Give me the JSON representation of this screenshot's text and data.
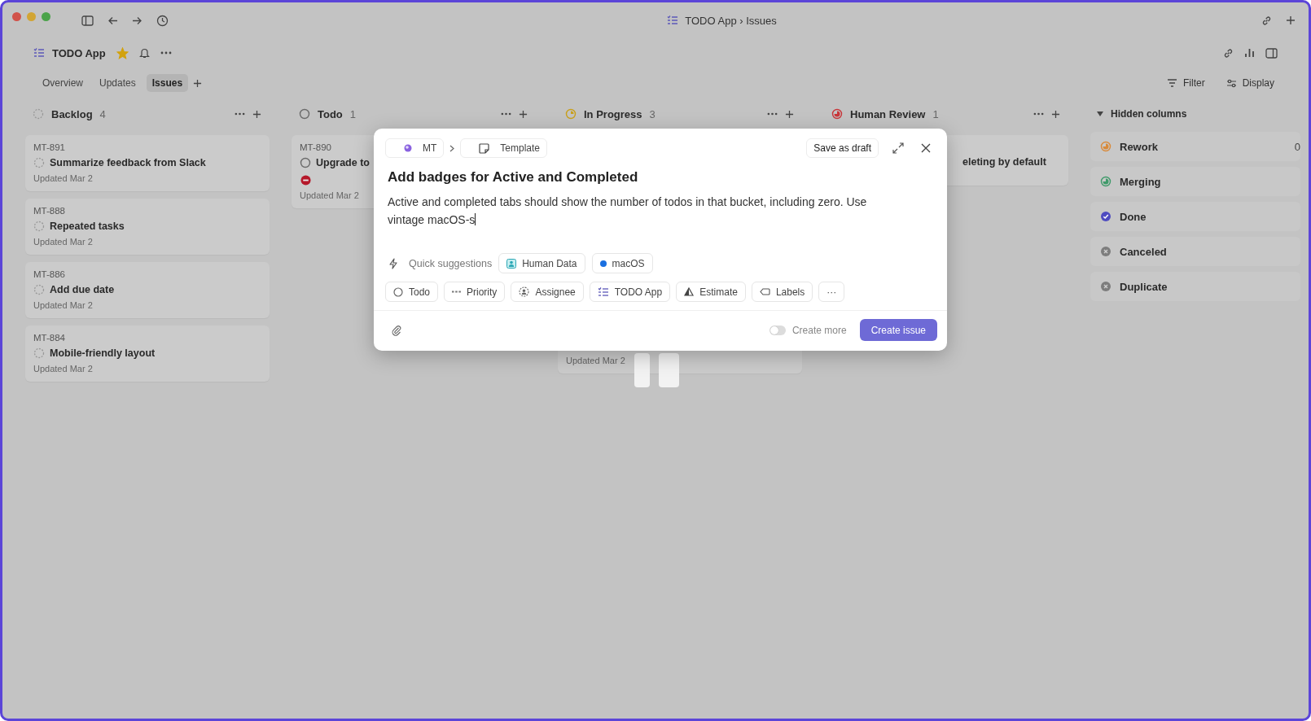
{
  "window": {
    "title": "TODO App › Issues"
  },
  "header": {
    "project": "TODO App",
    "starred": true
  },
  "tabs": [
    {
      "label": "Overview",
      "selected": false
    },
    {
      "label": "Updates",
      "selected": false
    },
    {
      "label": "Issues",
      "selected": true
    }
  ],
  "view_controls": [
    {
      "kind": "filter",
      "label": "Filter"
    },
    {
      "kind": "display",
      "label": "Display"
    }
  ],
  "columns": [
    {
      "name": "Backlog",
      "count": "4",
      "kind": "backlog",
      "cards": [
        {
          "id": "MT-891",
          "title": "Summarize feedback from Slack",
          "blocked": false,
          "updated": "Updated Mar 2"
        },
        {
          "id": "MT-888",
          "title": "Repeated tasks",
          "blocked": false,
          "updated": "Updated Mar 2"
        },
        {
          "id": "MT-886",
          "title": "Add due date",
          "blocked": false,
          "updated": "Updated Mar 2"
        },
        {
          "id": "MT-884",
          "title": "Mobile-friendly layout",
          "blocked": false,
          "updated": "Updated Mar 2"
        }
      ]
    },
    {
      "name": "Todo",
      "count": "1",
      "kind": "todo",
      "cards": [
        {
          "id": "MT-890",
          "title": "Upgrade to",
          "blocked": true,
          "updated": "Updated Mar 2"
        }
      ]
    },
    {
      "name": "In Progress",
      "count": "3",
      "kind": "in_progress",
      "cards": [
        {
          "updated": "Updated Mar 2"
        }
      ]
    },
    {
      "name": "Human Review",
      "count": "1",
      "kind": "review",
      "cards": [
        {
          "title": "eleting by default"
        }
      ]
    }
  ],
  "hidden_columns": {
    "title": "Hidden columns",
    "expanded": true,
    "items": [
      {
        "name": "Rework",
        "kind": "rework",
        "count": "0"
      },
      {
        "name": "Merging",
        "kind": "merging"
      },
      {
        "name": "Done",
        "kind": "done"
      },
      {
        "name": "Canceled",
        "kind": "canceled"
      },
      {
        "name": "Duplicate",
        "kind": "duplicate"
      }
    ]
  },
  "modal": {
    "team": "MT",
    "template": "Template",
    "save_draft": "Save as draft",
    "title": "Add badges for Active and Completed",
    "description": {
      "value": "Active and completed tabs should show the number of todos in that bucket, including zero. Use vintage macOS-s"
    },
    "suggestions_label": "Quick suggestions",
    "suggestions": [
      {
        "kind": "team",
        "label": "Human Data"
      },
      {
        "kind": "label",
        "label": "macOS",
        "color": "#1a6fe0"
      }
    ],
    "properties": [
      {
        "kind": "status",
        "label": "Todo"
      },
      {
        "kind": "priority",
        "label": "Priority"
      },
      {
        "kind": "assignee",
        "label": "Assignee"
      },
      {
        "kind": "project",
        "label": "TODO App"
      },
      {
        "kind": "estimate",
        "label": "Estimate"
      },
      {
        "kind": "labels",
        "label": "Labels"
      },
      {
        "kind": "more",
        "label": "···"
      }
    ],
    "create_more": {
      "label": "Create more",
      "on": false
    },
    "submit": "Create issue"
  }
}
